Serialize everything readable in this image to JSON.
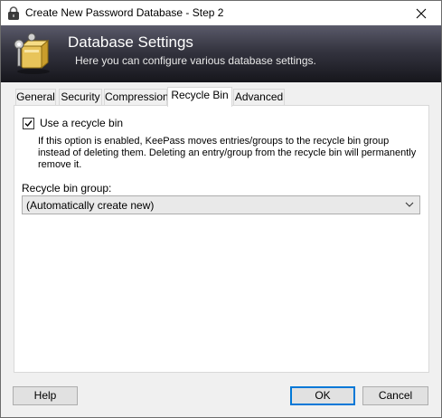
{
  "window": {
    "title": "Create New Password Database - Step 2"
  },
  "banner": {
    "title": "Database Settings",
    "subtitle": "Here you can configure various database settings."
  },
  "tabs": [
    {
      "label": "General"
    },
    {
      "label": "Security"
    },
    {
      "label": "Compression"
    },
    {
      "label": "Recycle Bin",
      "active": true
    },
    {
      "label": "Advanced"
    }
  ],
  "recycle": {
    "use_label": "Use a recycle bin",
    "checked": true,
    "description": "If this option is enabled, KeePass moves entries/groups to the recycle bin group instead of deleting them. Deleting an entry/group from the recycle bin will permanently remove it.",
    "group_label": "Recycle bin group:",
    "group_value": "(Automatically create new)"
  },
  "buttons": {
    "help": "Help",
    "ok": "OK",
    "cancel": "Cancel"
  },
  "colors": {
    "accent": "#0078d7",
    "banner_dark": "#16161c",
    "face": "#f0f0f0"
  }
}
